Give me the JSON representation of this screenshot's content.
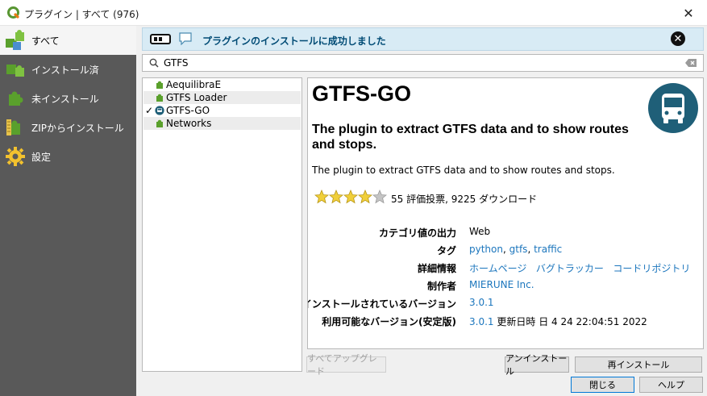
{
  "window": {
    "title": "プラグイン | すべて (976)",
    "close": "✕"
  },
  "sidebar": {
    "items": [
      {
        "label": "すべて",
        "icon": "puzzle-pieces-icon"
      },
      {
        "label": "インストール済",
        "icon": "puzzle-pieces-icon"
      },
      {
        "label": "未インストール",
        "icon": "puzzle-piece-icon"
      },
      {
        "label": "ZIPからインストール",
        "icon": "zip-puzzle-icon"
      },
      {
        "label": "設定",
        "icon": "gear-icon"
      }
    ]
  },
  "banner": {
    "message": "プラグインのインストールに成功しました",
    "close": "✕"
  },
  "search": {
    "value": "GTFS",
    "placeholder": ""
  },
  "plugin_list": [
    {
      "name": "AequilibraE",
      "checked": "",
      "icon": "puzzle-piece-icon"
    },
    {
      "name": "GTFS Loader",
      "checked": "",
      "icon": "puzzle-piece-icon"
    },
    {
      "name": "GTFS-GO",
      "checked": "✓",
      "icon": "bus-icon"
    },
    {
      "name": "Networks",
      "checked": "",
      "icon": "puzzle-piece-icon"
    }
  ],
  "details": {
    "title": "GTFS-GO",
    "subtitle": "The plugin to extract GTFS data and to show routes and stops.",
    "description": "The plugin to extract GTFS data and to show routes and stops.",
    "rating": 4,
    "rating_max": 5,
    "votes": "55 評価投票, 9225 ダウンロード",
    "category_label": "カテゴリ値の出力",
    "category": "Web",
    "tags_label": "タグ",
    "tags": [
      "python",
      "gtfs",
      "traffic"
    ],
    "links_label": "詳細情報",
    "links": [
      "ホームページ",
      "バグトラッカー",
      "コードリポジトリ"
    ],
    "author_label": "制作者",
    "author": "MIERUNE Inc.",
    "installed_label": "インストールされているバージョン",
    "installed_version": "3.0.1",
    "available_label": "利用可能なバージョン(安定版)",
    "available_version": "3.0.1",
    "updated": "更新日時 日 4 24 22:04:51 2022"
  },
  "buttons": {
    "upgrade_all": "すべてアップグレード",
    "uninstall": "アンインストール",
    "reinstall": "再インストール",
    "close": "閉じる",
    "help": "ヘルプ"
  },
  "colors": {
    "sidebar": "#595959",
    "banner": "#d8ebf5",
    "link": "#1c76bd",
    "logo": "#1f5f78"
  }
}
